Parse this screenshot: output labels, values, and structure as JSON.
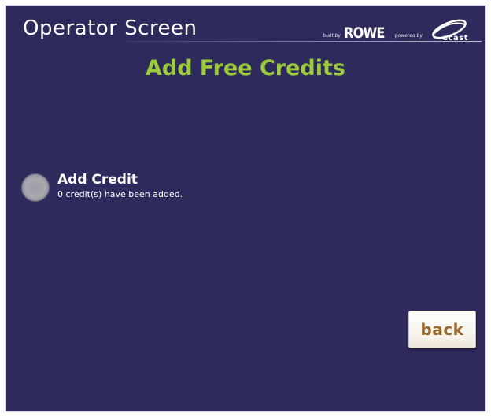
{
  "header": {
    "title": "Operator Screen",
    "brand": {
      "built_by": "built by",
      "rowe": "ROWE",
      "powered_by": "powered by",
      "ecast": "ecast"
    }
  },
  "page": {
    "title": "Add Free Credits",
    "title_color": "#9ccc38",
    "background_color": "#2e2a5c"
  },
  "credit_option": {
    "label": "Add Credit",
    "status": "0 credit(s) have been added."
  },
  "back_button": {
    "label": "back",
    "label_color": "#9a6a2c"
  }
}
